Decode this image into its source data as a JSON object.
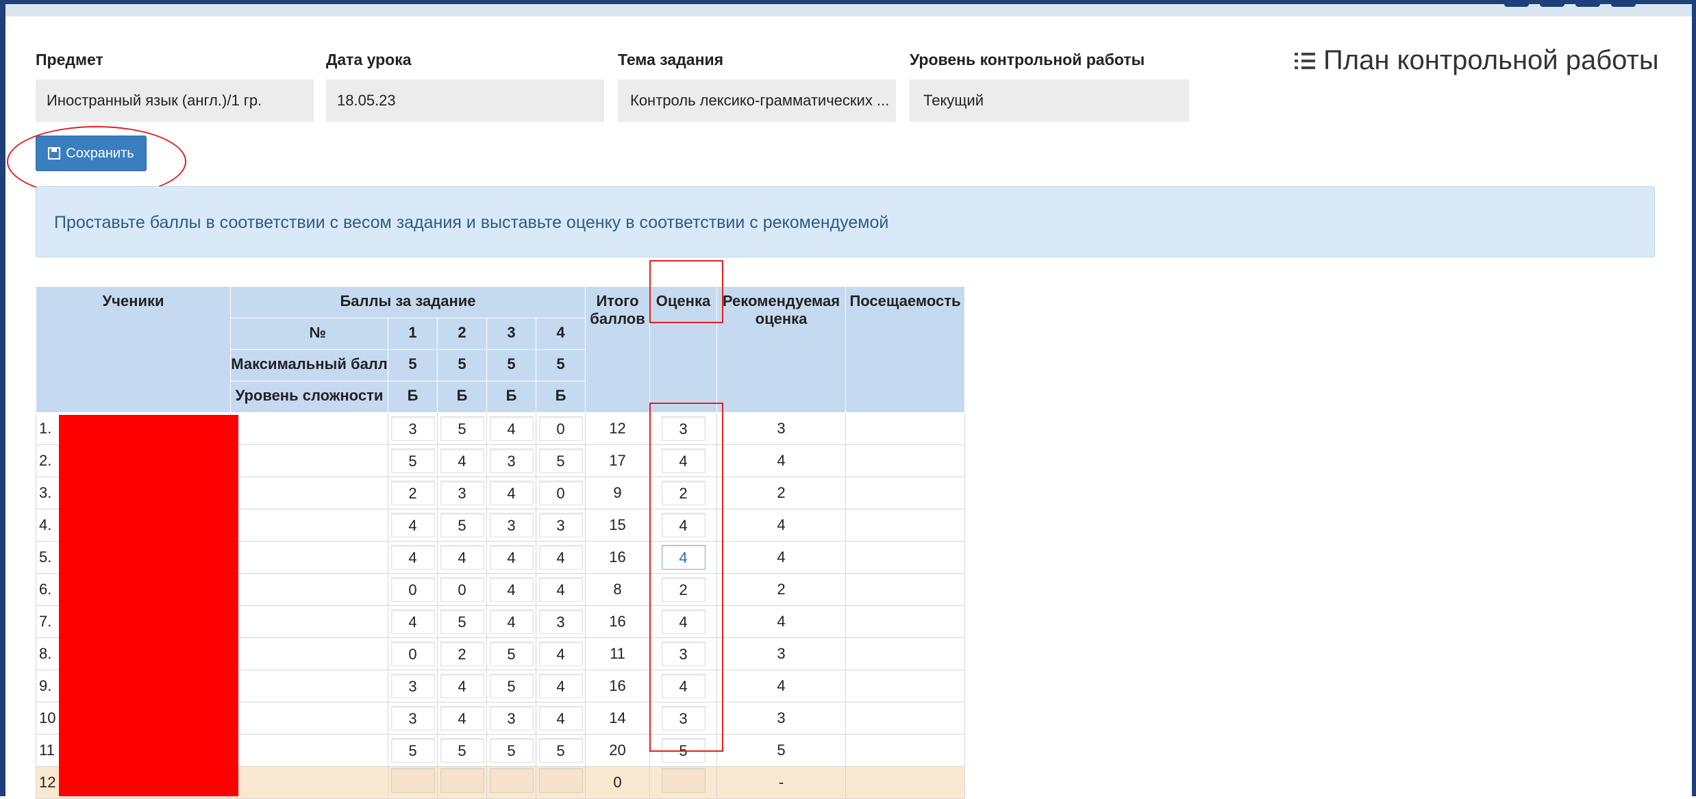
{
  "fields": {
    "subject": {
      "label": "Предмет",
      "value": "Иностранный язык (англ.)/1 гр."
    },
    "date": {
      "label": "Дата урока",
      "value": "18.05.23"
    },
    "topic": {
      "label": "Тема задания",
      "value": "Контроль лексико-грамматических ..."
    },
    "level": {
      "label": "Уровень контрольной работы",
      "value": "Текущий"
    }
  },
  "plan_link": "План контрольной работы",
  "save_button": "Сохранить",
  "info_text": "Проставьте баллы в соответствии с весом задания и выставьте оценку в соответствии с рекомендуемой",
  "table": {
    "headers": {
      "students": "Ученики",
      "scores": "Баллы за задание",
      "number": "№",
      "max_score": "Максимальный балл",
      "difficulty": "Уровень сложности",
      "total_1": "Итого",
      "total_2": "баллов",
      "grade": "Оценка",
      "recommended_1": "Рекомендуемая",
      "recommended_2": "оценка",
      "attendance": "Посещаемость"
    },
    "tasks": [
      "1",
      "2",
      "3",
      "4"
    ],
    "max": [
      "5",
      "5",
      "5",
      "5"
    ],
    "levels": [
      "Б",
      "Б",
      "Б",
      "Б"
    ],
    "rows": [
      {
        "n": "1.",
        "scores": [
          "3",
          "5",
          "4",
          "0"
        ],
        "total": "12",
        "grade": "3",
        "rec": "3"
      },
      {
        "n": "2.",
        "scores": [
          "5",
          "4",
          "3",
          "5"
        ],
        "total": "17",
        "grade": "4",
        "rec": "4"
      },
      {
        "n": "3.",
        "scores": [
          "2",
          "3",
          "4",
          "0"
        ],
        "total": "9",
        "grade": "2",
        "rec": "2"
      },
      {
        "n": "4.",
        "scores": [
          "4",
          "5",
          "3",
          "3"
        ],
        "total": "15",
        "grade": "4",
        "rec": "4"
      },
      {
        "n": "5.",
        "scores": [
          "4",
          "4",
          "4",
          "4"
        ],
        "total": "16",
        "grade": "4",
        "rec": "4"
      },
      {
        "n": "6.",
        "scores": [
          "0",
          "0",
          "4",
          "4"
        ],
        "total": "8",
        "grade": "2",
        "rec": "2"
      },
      {
        "n": "7.",
        "scores": [
          "4",
          "5",
          "4",
          "3"
        ],
        "total": "16",
        "grade": "4",
        "rec": "4"
      },
      {
        "n": "8.",
        "scores": [
          "0",
          "2",
          "5",
          "4"
        ],
        "total": "11",
        "grade": "3",
        "rec": "3"
      },
      {
        "n": "9.",
        "scores": [
          "3",
          "4",
          "5",
          "4"
        ],
        "total": "16",
        "grade": "4",
        "rec": "4"
      },
      {
        "n": "10",
        "scores": [
          "3",
          "4",
          "3",
          "4"
        ],
        "total": "14",
        "grade": "3",
        "rec": "3"
      },
      {
        "n": "11",
        "scores": [
          "5",
          "5",
          "5",
          "5"
        ],
        "total": "20",
        "grade": "5",
        "rec": "5"
      },
      {
        "n": "12",
        "scores": [
          "",
          "",
          "",
          ""
        ],
        "total": "0",
        "grade": "",
        "rec": "-"
      }
    ]
  },
  "colors": {
    "frame": "#1f3f7a",
    "button": "#3a7ec0",
    "header_bg": "#c5daf0",
    "info_bg": "#d9e9f7",
    "annotation": "#e02020",
    "redaction": "#ff0000",
    "new_row_bg": "#fbe8d0"
  }
}
